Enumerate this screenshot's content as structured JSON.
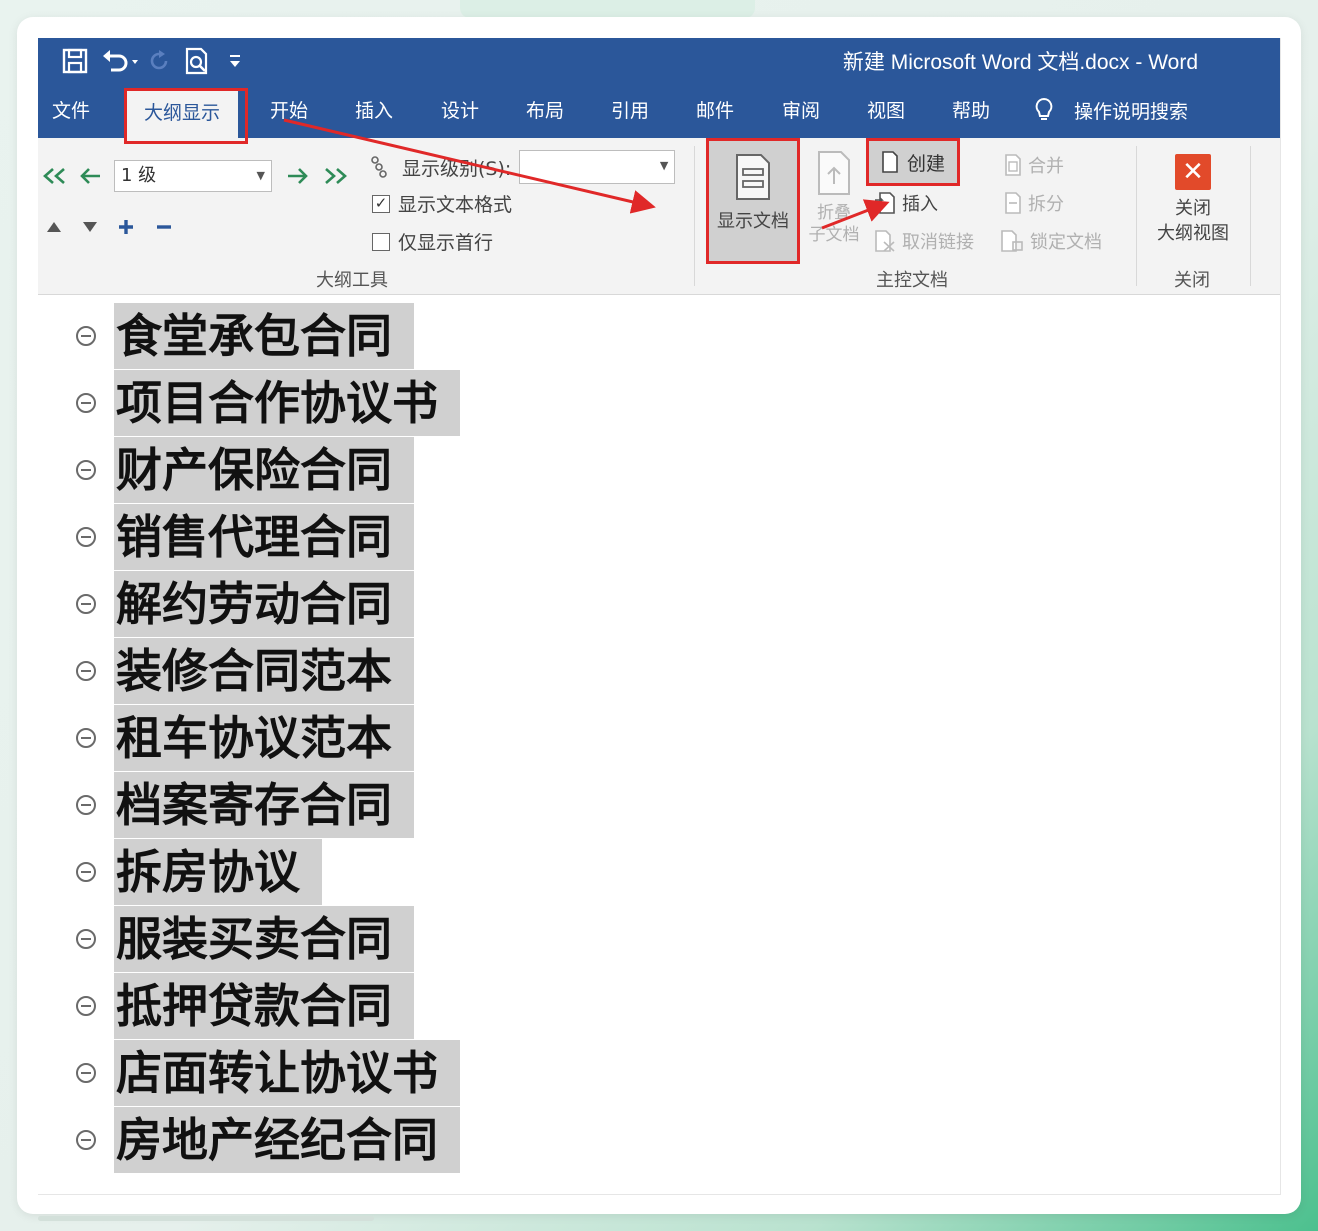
{
  "window": {
    "title": "新建 Microsoft Word 文档.docx  -  Word"
  },
  "quick_access": {
    "icons": [
      "save-icon",
      "undo-icon",
      "redo-icon",
      "print-preview-icon",
      "customize-icon"
    ]
  },
  "tabs": [
    {
      "label": "文件",
      "active": false
    },
    {
      "label": "大纲显示",
      "active": true
    },
    {
      "label": "开始",
      "active": false
    },
    {
      "label": "插入",
      "active": false
    },
    {
      "label": "设计",
      "active": false
    },
    {
      "label": "布局",
      "active": false
    },
    {
      "label": "引用",
      "active": false
    },
    {
      "label": "邮件",
      "active": false
    },
    {
      "label": "审阅",
      "active": false
    },
    {
      "label": "视图",
      "active": false
    },
    {
      "label": "帮助",
      "active": false
    }
  ],
  "tell_me": {
    "label": "操作说明搜索"
  },
  "outline_tools": {
    "group_label": "大纲工具",
    "level_value": "1 级",
    "show_level_label": "显示级别(S):",
    "show_level_value": "",
    "show_text_format": {
      "label": "显示文本格式",
      "checked": true
    },
    "show_first_line": {
      "label": "仅显示首行",
      "checked": false
    }
  },
  "master_document": {
    "group_label": "主控文档",
    "show_document": "显示文档",
    "collapse_subdocs_line1": "折叠",
    "collapse_subdocs_line2": "子文档",
    "create": "创建",
    "insert": "插入",
    "unlink": "取消链接",
    "merge": "合并",
    "split": "拆分",
    "lock_document": "锁定文档"
  },
  "close_group": {
    "group_label": "关闭",
    "close_line1": "关闭",
    "close_line2": "大纲视图"
  },
  "colors": {
    "ribbon_blue": "#2b579a",
    "highlight_red": "#e02828",
    "close_orange": "#e24a2a"
  },
  "outline_items": [
    "食堂承包合同",
    "项目合作协议书",
    "财产保险合同",
    "销售代理合同",
    "解约劳动合同",
    "装修合同范本",
    "租车协议范本",
    "档案寄存合同",
    "拆房协议",
    "服装买卖合同",
    "抵押贷款合同",
    "店面转让协议书",
    "房地产经纪合同"
  ]
}
